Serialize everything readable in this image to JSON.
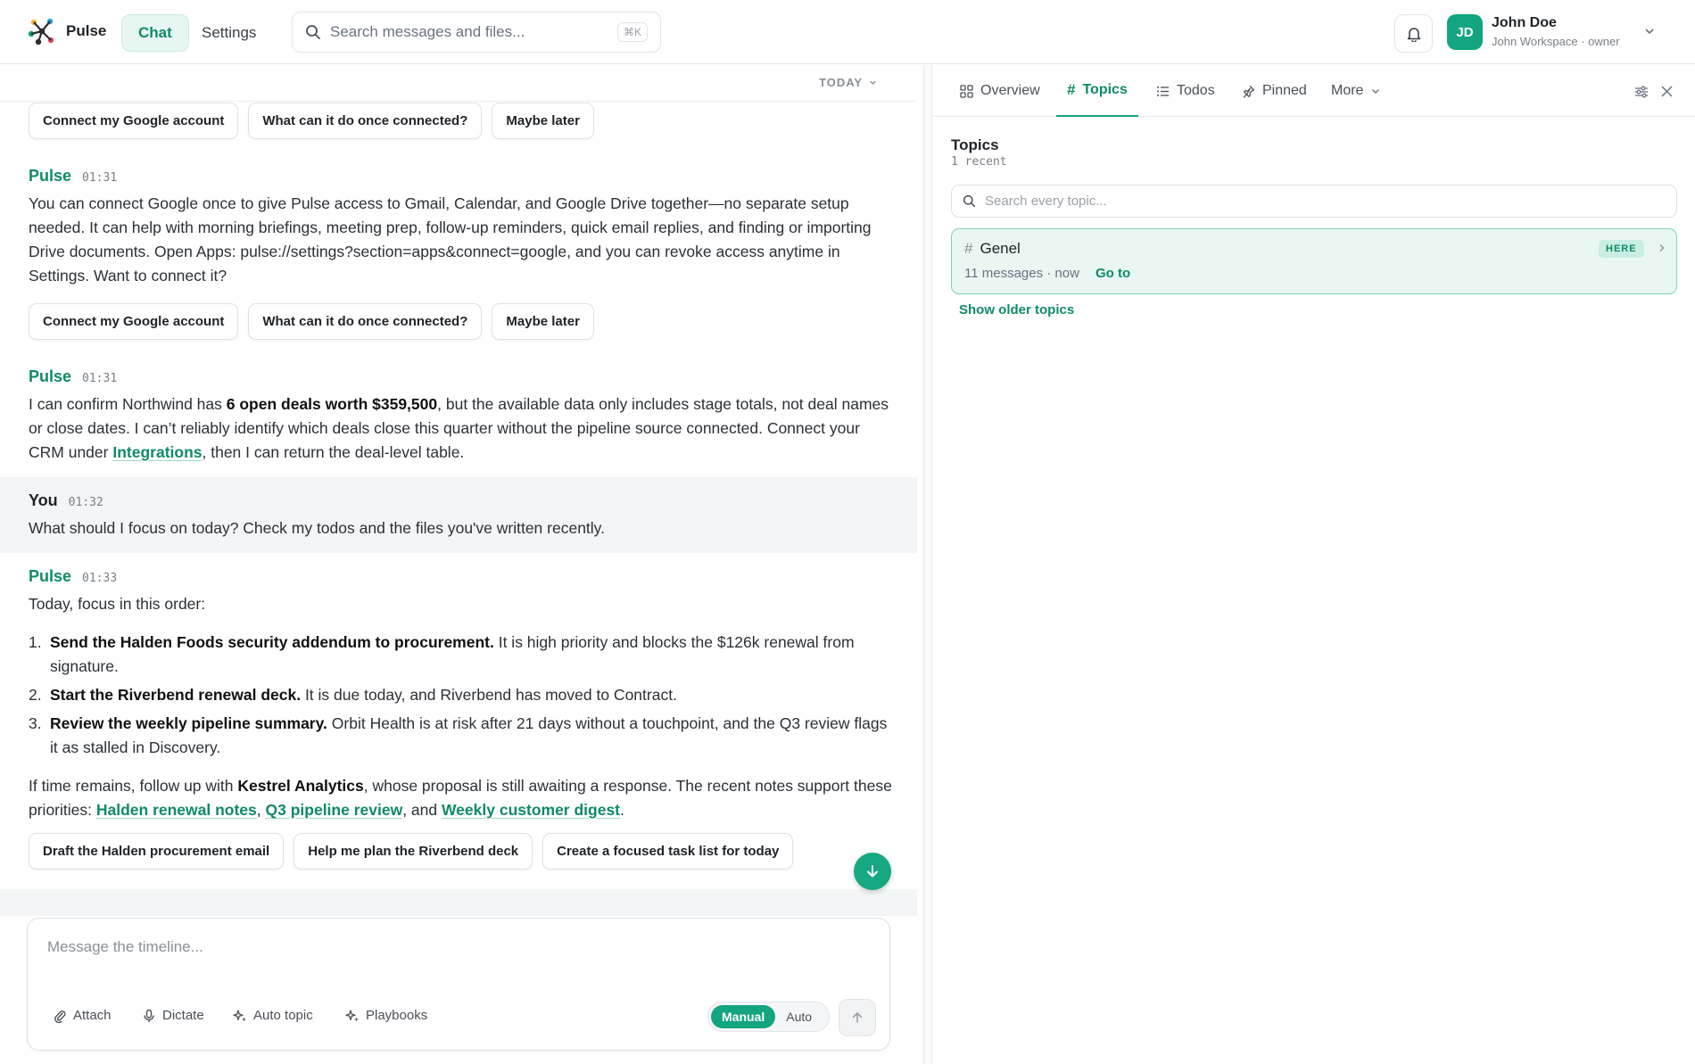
{
  "app": {
    "name": "Pulse"
  },
  "nav": {
    "chat": "Chat",
    "settings": "Settings"
  },
  "search": {
    "placeholder": "Search messages and files...",
    "shortcut": "⌘K"
  },
  "user": {
    "initials": "JD",
    "name": "John Doe",
    "workspace": "John Workspace · owner"
  },
  "chat": {
    "day_label": "TODAY",
    "chips_1": [
      "Connect my Google account",
      "What can it do once connected?",
      "Maybe later"
    ],
    "msg_1": {
      "sender": "Pulse",
      "time": "01:31",
      "text": "You can connect Google once to give Pulse access to Gmail, Calendar, and Google Drive together—no separate setup needed. It can help with morning briefings, meeting prep, follow-up reminders, quick email replies, and finding or importing Drive documents. Open Apps: pulse://settings?section=apps&connect=google, and you can revoke access anytime in Settings. Want to connect it?"
    },
    "chips_2": [
      "Connect my Google account",
      "What can it do once connected?",
      "Maybe later"
    ],
    "msg_2": {
      "sender": "Pulse",
      "time": "01:31",
      "t1": "I can confirm Northwind has ",
      "t2": "6 open deals worth $359,500",
      "t3": ", but the available data only includes stage totals, not deal names or close dates. I can’t reliably identify which deals close this quarter without the pipeline source connected. Connect your CRM under ",
      "link": "Integrations",
      "t4": ", then I can return the deal-level table."
    },
    "msg_3": {
      "sender": "You",
      "time": "01:32",
      "text": "What should I focus on today? Check my todos and the files you've written recently."
    },
    "msg_4": {
      "sender": "Pulse",
      "time": "01:33",
      "intro": "Today, focus in this order:",
      "items": [
        {
          "num": "1.",
          "bold": "Send the Halden Foods security addendum to procurement.",
          "rest": " It is high priority and blocks the $126k renewal from signature."
        },
        {
          "num": "2.",
          "bold": "Start the Riverbend renewal deck.",
          "rest": " It is due today, and Riverbend has moved to Contract."
        },
        {
          "num": "3.",
          "bold": "Review the weekly pipeline summary.",
          "rest": " Orbit Health is at risk after 21 days without a touchpoint, and the Q3 review flags it as stalled in Discovery."
        }
      ],
      "o1": "If time remains, follow up with ",
      "o_bold": "Kestrel Analytics",
      "o2": ", whose proposal is still awaiting a response. The recent notes support these priorities: ",
      "link1": "Halden renewal notes",
      "sep1": ", ",
      "link2": "Q3 pipeline review",
      "sep2": ", and ",
      "link3": "Weekly customer digest",
      "end": "."
    },
    "chips_3": [
      "Draft the Halden procurement email",
      "Help me plan the Riverbend deck",
      "Create a focused task list for today"
    ],
    "composer": {
      "placeholder": "Message the timeline...",
      "tools": [
        "Attach",
        "Dictate",
        "Auto topic",
        "Playbooks"
      ],
      "mode_on": "Manual",
      "mode_off": "Auto"
    }
  },
  "side": {
    "tabs": [
      "Overview",
      "Topics",
      "Todos",
      "Pinned",
      "More"
    ],
    "active_tab": "Topics",
    "title": "Topics",
    "subtitle": "1 recent",
    "search_placeholder": "Search every topic...",
    "topic": {
      "name": "Genel",
      "meta": "11 messages · now",
      "goto": "Go to",
      "badge": "HERE"
    },
    "older": "Show older topics"
  },
  "colors": {
    "accent": "#12a57f",
    "accent_text": "#0f8a69"
  }
}
